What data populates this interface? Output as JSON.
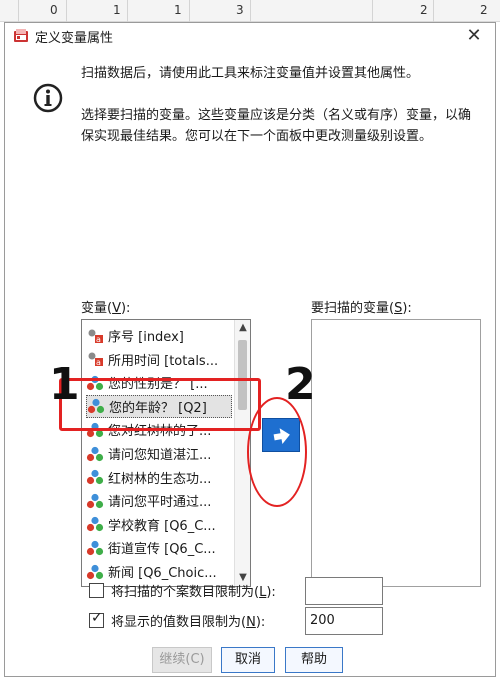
{
  "spreadsheet": {
    "cells": [
      "0",
      "1",
      "1",
      "3",
      "2",
      "2"
    ]
  },
  "dialog": {
    "title": "定义变量属性",
    "close_glyph": "✕",
    "message_line1": "扫描数据后，请使用此工具来标注变量值并设置其他属性。",
    "message_line2": "选择要扫描的变量。这些变量应该是分类（名义或有序）变量，以确保实现最佳结果。您可以在下一个面板中更改测量级别设置。"
  },
  "variables_panel": {
    "label_prefix": "变量(",
    "label_mnemonic": "V",
    "label_suffix": "):",
    "items": [
      {
        "label": "序号 [index]",
        "icon": "scale-ruler-icon"
      },
      {
        "label": "所用时间 [totals...",
        "icon": "scale-ruler-icon"
      },
      {
        "label": "您的性别是？ [...",
        "icon": "nominal-icon"
      },
      {
        "label": "您的年龄？ [Q2]",
        "icon": "nominal-icon",
        "selected": true
      },
      {
        "label": "您对红树林的了...",
        "icon": "nominal-icon"
      },
      {
        "label": "请问您知道湛江...",
        "icon": "nominal-icon"
      },
      {
        "label": "红树林的生态功...",
        "icon": "nominal-icon"
      },
      {
        "label": "请问您平时通过...",
        "icon": "nominal-icon"
      },
      {
        "label": "学校教育 [Q6_C...",
        "icon": "nominal-icon"
      },
      {
        "label": "街道宣传 [Q6_C...",
        "icon": "nominal-icon"
      },
      {
        "label": "新闻 [Q6_Choic...",
        "icon": "nominal-icon"
      }
    ]
  },
  "scan_panel": {
    "label_prefix": "要扫描的变量(",
    "label_mnemonic": "S",
    "label_suffix": "):"
  },
  "limit_cases": {
    "label_prefix": "将扫描的个案数目限制为(",
    "label_mnemonic": "L",
    "label_suffix": "):",
    "checked": false,
    "value": ""
  },
  "limit_values": {
    "label_prefix": "将显示的值数目限制为(",
    "label_mnemonic": "N",
    "label_suffix": "):",
    "checked": true,
    "value": "200"
  },
  "buttons": {
    "continue": "继续(C)",
    "cancel": "取消",
    "help": "帮助"
  },
  "annotations": {
    "number1": "1",
    "number2": "2"
  },
  "colors": {
    "accent": "#1e6fd0",
    "annotation": "#e32222"
  }
}
